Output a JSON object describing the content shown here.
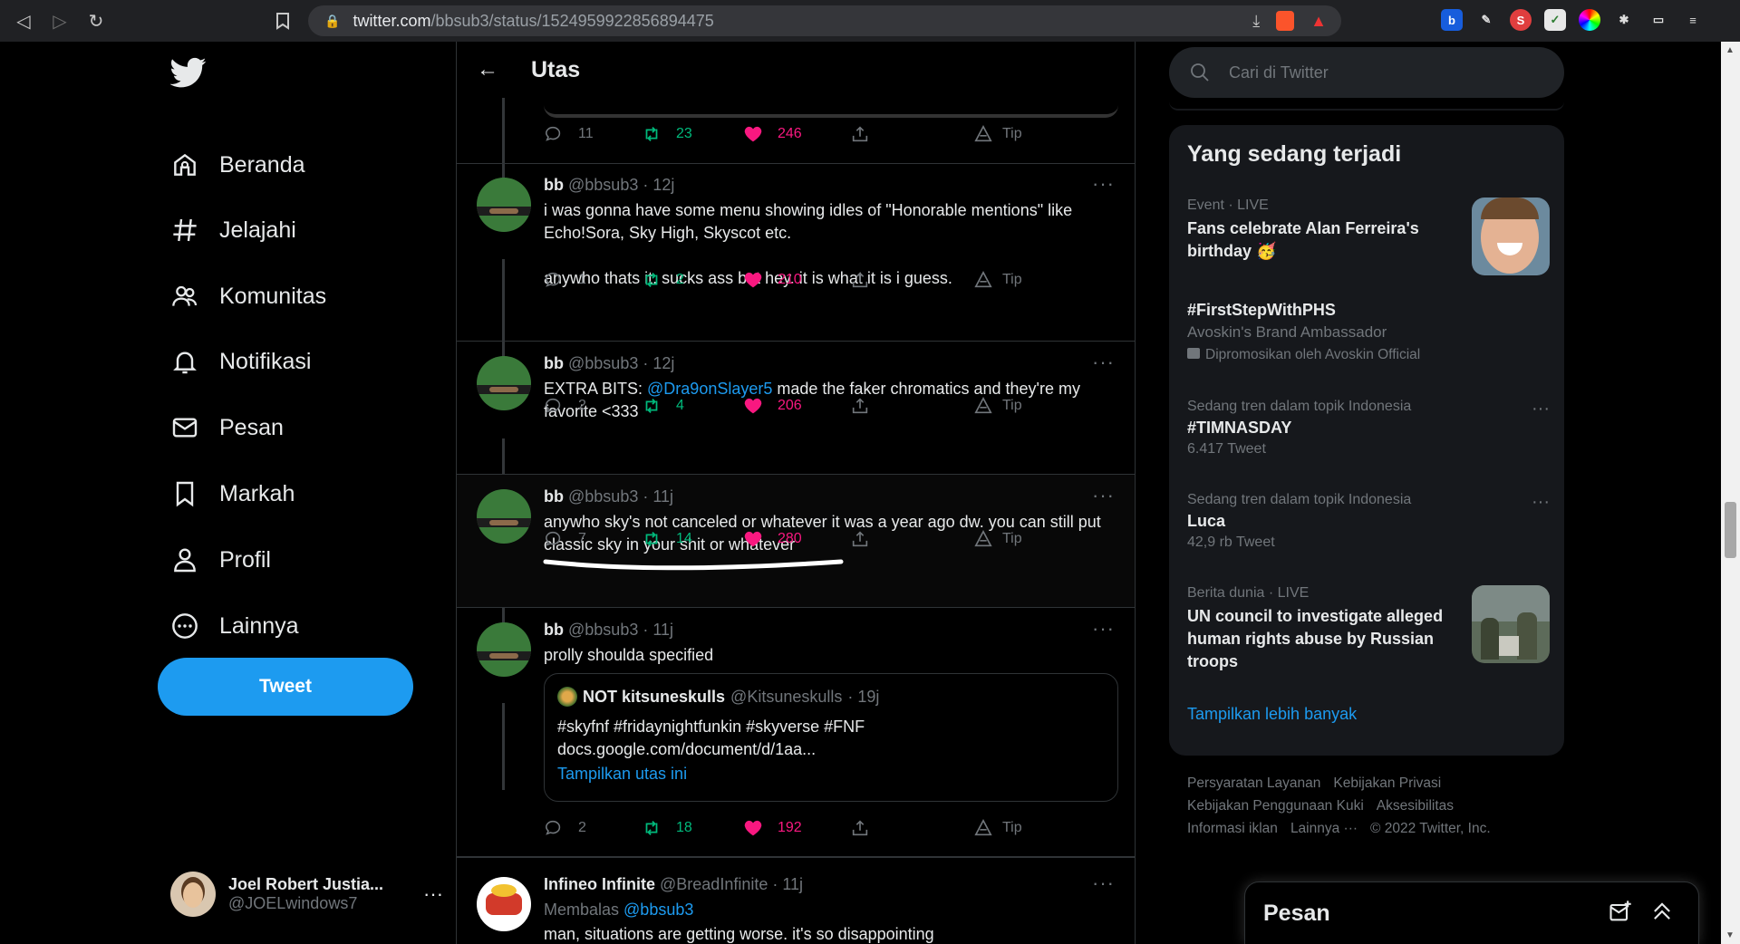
{
  "browser": {
    "url_host": "twitter.com",
    "url_path": "/bbsub3/status/1524959922856894475"
  },
  "nav": {
    "items": [
      "Beranda",
      "Jelajahi",
      "Komunitas",
      "Notifikasi",
      "Pesan",
      "Markah",
      "Profil",
      "Lainnya"
    ],
    "tweet_button": "Tweet",
    "account_name": "Joel Robert Justia...",
    "account_handle": "@JOELwindows7"
  },
  "thread": {
    "title": "Utas",
    "top_actions": {
      "reply": "11",
      "retweet": "23",
      "like": "246",
      "tip": "Tip"
    },
    "tweets": [
      {
        "name": "bb",
        "handle": "@bbsub3",
        "time": "· 12j",
        "line1": "i was gonna have some menu showing idles of \"Honorable mentions\" like Echo!Sora, Sky High, Skyscot etc.",
        "line2": "anywho thats it. sucks ass but hey. it is what it is i guess.",
        "reply": "1",
        "retweet": "2",
        "like": "210",
        "tip": "Tip"
      },
      {
        "name": "bb",
        "handle": "@bbsub3",
        "time": "· 12j",
        "pre": "EXTRA BITS: ",
        "mention": "@Dra9onSlayer5",
        "post": " made the faker chromatics and they're my favorite <333",
        "reply": "2",
        "retweet": "4",
        "like": "206",
        "tip": "Tip"
      },
      {
        "name": "bb",
        "handle": "@bbsub3",
        "time": "· 11j",
        "text": "anywho sky's not canceled or whatever it was a year ago dw. you can still put classic sky in your shit or whatever",
        "reply": "7",
        "retweet": "14",
        "like": "280",
        "tip": "Tip"
      },
      {
        "name": "bb",
        "handle": "@bbsub3",
        "time": "· 11j",
        "text": "prolly shoulda specified",
        "quote": {
          "name": "NOT kitsuneskulls",
          "handle": "@Kitsuneskulls",
          "time": "· 19j",
          "line1": "#skyfnf #fridaynightfunkin #skyverse #FNF",
          "line2": "docs.google.com/document/d/1aa...",
          "show": "Tampilkan utas ini"
        },
        "reply": "2",
        "retweet": "18",
        "like": "192",
        "tip": "Tip"
      },
      {
        "name": "Infineo Infinite",
        "handle": "@BreadInfinite",
        "time": "· 11j",
        "reply_pre": "Membalas ",
        "reply_to": "@bbsub3",
        "text": "man, situations are getting worse. it's so disappointing"
      }
    ]
  },
  "sidebar": {
    "search_placeholder": "Cari di Twitter",
    "trends_title": "Yang sedang terjadi",
    "trends": [
      {
        "cap": "Event · LIVE",
        "title": "Fans celebrate Alan Ferreira's birthday 🥳"
      },
      {
        "title": "#FirstStepWithPHS",
        "sub": "Avoskin's Brand Ambassador",
        "promo": "Dipromosikan oleh Avoskin Official"
      },
      {
        "cap": "Sedang tren dalam topik Indonesia",
        "title": "#TIMNASDAY",
        "sub": "6.417 Tweet"
      },
      {
        "cap": "Sedang tren dalam topik Indonesia",
        "title": "Luca",
        "sub": "42,9 rb Tweet"
      },
      {
        "cap": "Berita dunia · LIVE",
        "title": "UN council to investigate alleged human rights abuse by Russian troops"
      }
    ],
    "show_more": "Tampilkan lebih banyak",
    "footer": [
      "Persyaratan Layanan",
      "Kebijakan Privasi",
      "Kebijakan Penggunaan Kuki",
      "Aksesibilitas",
      "Informasi iklan",
      "Lainnya ···",
      "© 2022 Twitter, Inc."
    ]
  },
  "messages": {
    "title": "Pesan"
  },
  "colors": {
    "accent": "#1d9bf0",
    "retweet": "#00ba7c",
    "like": "#f91880",
    "muted": "#71767b"
  }
}
